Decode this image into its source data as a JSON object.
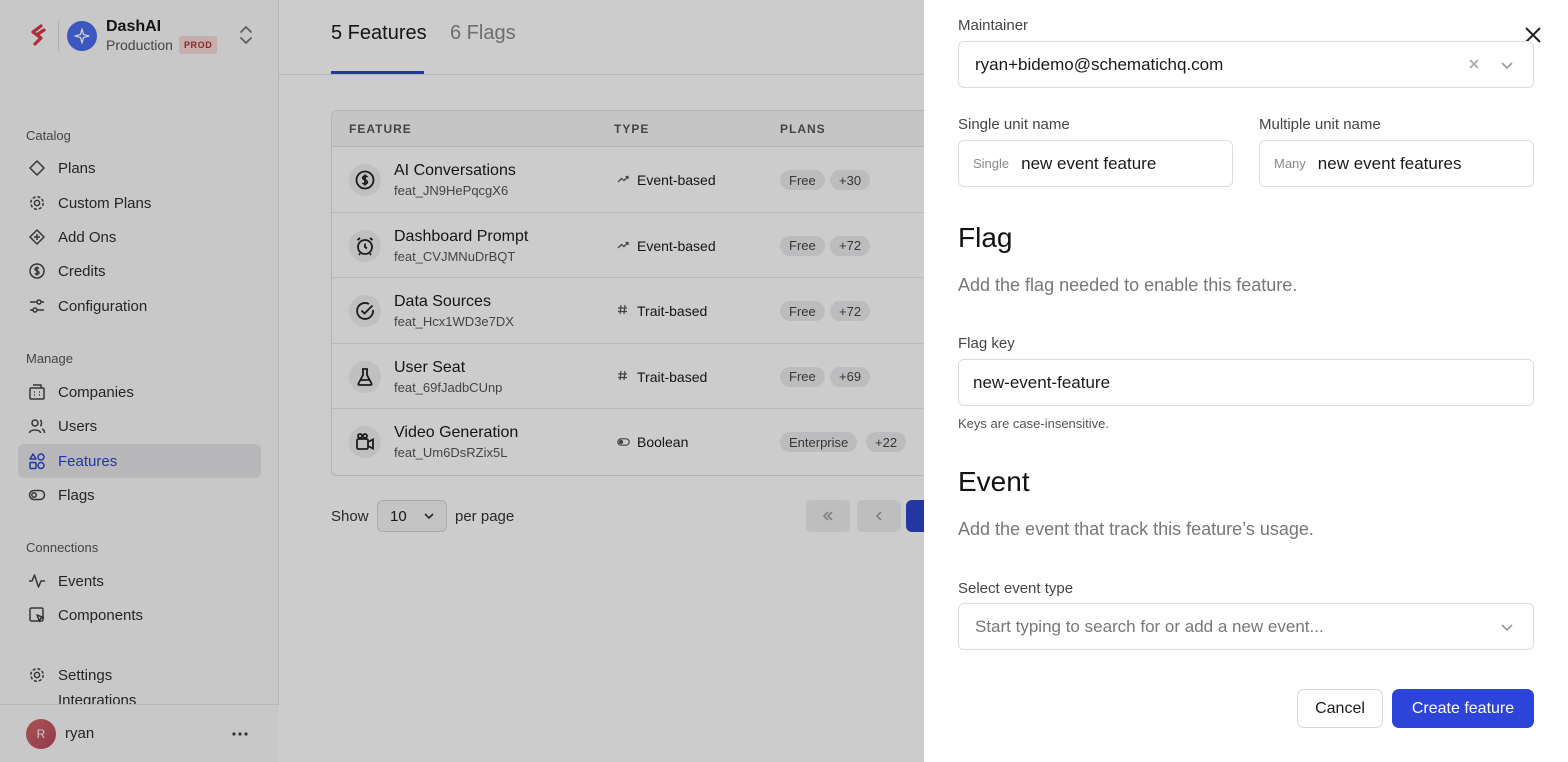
{
  "workspace": {
    "name": "DashAI",
    "environment": "Production",
    "env_badge": "PROD"
  },
  "sidebar": {
    "sections": [
      {
        "title": "Catalog",
        "items": [
          {
            "label": "Plans",
            "icon": "diamond-icon"
          },
          {
            "label": "Custom Plans",
            "icon": "gear-icon"
          },
          {
            "label": "Add Ons",
            "icon": "diamond-plus-icon"
          },
          {
            "label": "Credits",
            "icon": "dollar-icon"
          },
          {
            "label": "Configuration",
            "icon": "sliders-icon"
          }
        ]
      },
      {
        "title": "Manage",
        "items": [
          {
            "label": "Companies",
            "icon": "building-icon"
          },
          {
            "label": "Users",
            "icon": "users-icon"
          },
          {
            "label": "Features",
            "icon": "features-icon",
            "active": true
          },
          {
            "label": "Flags",
            "icon": "toggle-icon"
          }
        ]
      },
      {
        "title": "Connections",
        "items": [
          {
            "label": "Events",
            "icon": "activity-icon"
          },
          {
            "label": "Components",
            "icon": "components-icon"
          }
        ]
      }
    ],
    "settings_label": "Settings",
    "cut_off_label": "Integrations",
    "user": {
      "initial": "R",
      "name": "ryan"
    }
  },
  "main": {
    "tabs": [
      {
        "label": "5 Features",
        "active": true
      },
      {
        "label": "6 Flags",
        "active": false
      }
    ],
    "columns": [
      "FEATURE",
      "TYPE",
      "PLANS"
    ],
    "rows": [
      {
        "name": "AI Conversations",
        "id": "feat_JN9HePqcgX6",
        "type": "Event-based",
        "type_icon": "trend-icon",
        "icon": "dollar-circle-icon",
        "plan": "Free",
        "more": "+30"
      },
      {
        "name": "Dashboard Prompt",
        "id": "feat_CVJMNuDrBQT",
        "type": "Event-based",
        "type_icon": "trend-icon",
        "icon": "alarm-icon",
        "plan": "Free",
        "more": "+72"
      },
      {
        "name": "Data Sources",
        "id": "feat_Hcx1WD3e7DX",
        "type": "Trait-based",
        "type_icon": "hash-icon",
        "icon": "check-circle-icon",
        "plan": "Free",
        "more": "+72"
      },
      {
        "name": "User Seat",
        "id": "feat_69fJadbCUnp",
        "type": "Trait-based",
        "type_icon": "hash-icon",
        "icon": "flask-icon",
        "plan": "Free",
        "more": "+69"
      },
      {
        "name": "Video Generation",
        "id": "feat_Um6DsRZix5L",
        "type": "Boolean",
        "type_icon": "toggle-icon",
        "icon": "video-icon",
        "plan": "Enterprise",
        "more": "+22"
      }
    ],
    "pager": {
      "show_label": "Show",
      "per_page_value": "10",
      "per_page_label": "per page"
    }
  },
  "drawer": {
    "maintainer_label": "Maintainer",
    "maintainer_value": "ryan+bidemo@schematichq.com",
    "single_unit_label": "Single unit name",
    "single_prefix": "Single",
    "single_value": "new event feature",
    "multiple_unit_label": "Multiple unit name",
    "multiple_prefix": "Many",
    "multiple_value": "new event features",
    "flag_title": "Flag",
    "flag_desc": "Add the flag needed to enable this feature.",
    "flag_key_label": "Flag key",
    "flag_key_value": "new-event-feature",
    "flag_hint": "Keys are case-insensitive.",
    "event_title": "Event",
    "event_desc": "Add the event that track this feature’s usage.",
    "event_type_label": "Select event type",
    "event_placeholder": "Start typing to search for or add a new event...",
    "cancel_label": "Cancel",
    "create_label": "Create feature"
  },
  "colors": {
    "accent": "#2d44c8",
    "primary_button": "#2d44d8",
    "prod_badge_bg": "#f8dada"
  }
}
